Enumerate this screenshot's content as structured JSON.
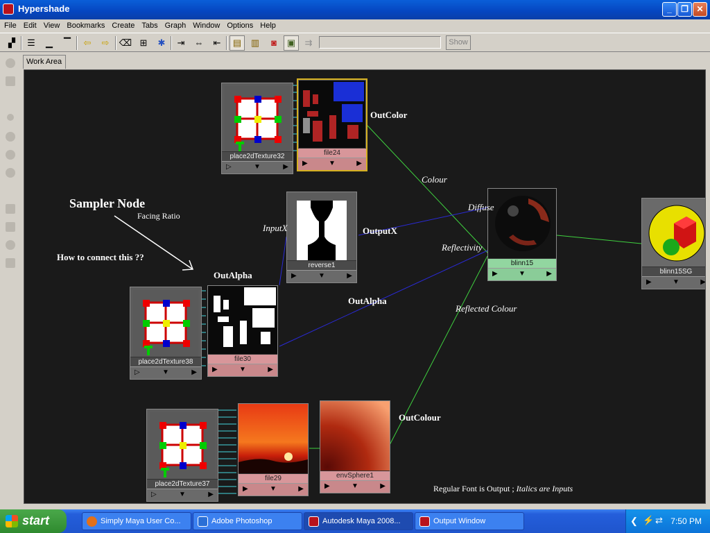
{
  "window": {
    "title": "Hypershade"
  },
  "menu": [
    "File",
    "Edit",
    "View",
    "Bookmarks",
    "Create",
    "Tabs",
    "Graph",
    "Window",
    "Options",
    "Help"
  ],
  "toolbar": {
    "show_label": "Show"
  },
  "tabs": {
    "work_area": "Work Area"
  },
  "nodes": {
    "place2dTexture32": "place2dTexture32",
    "file24": "file24",
    "reverse1": "reverse1",
    "blinn15": "blinn15",
    "blinn15SG": "blinn15SG",
    "place2dTexture38": "place2dTexture38",
    "file30": "file30",
    "place2dTexture37": "place2dTexture37",
    "file29": "file29",
    "envSphere1": "envSphere1"
  },
  "annotations": {
    "out_color": "OutColor",
    "colour": "Colour",
    "diffuse": "Diffuse",
    "sampler_node": "Sampler Node",
    "facing_ratio": "Facing Ratio",
    "input_x": "InputX",
    "output_x": "OutputX",
    "reflectivity": "Reflectivity",
    "how_to_connect": "How to connect this ??",
    "out_alpha_1": "OutAlpha",
    "out_alpha_2": "OutAlpha",
    "reflected_colour": "Reflected Colour",
    "out_colour": "OutColour",
    "legend_regular": "Regular Font is Output ; ",
    "legend_italic": "Italics are Inputs"
  },
  "taskbar": {
    "start": "start",
    "tasks": [
      "Simply Maya User Co...",
      "Adobe Photoshop",
      "Autodesk Maya 2008...",
      "Output Window"
    ],
    "time": "7:50 PM"
  },
  "colors": {
    "wire_green": "#3fd13f",
    "wire_blue": "#2a2ad6",
    "workarea_bg": "#1a1a1a"
  }
}
